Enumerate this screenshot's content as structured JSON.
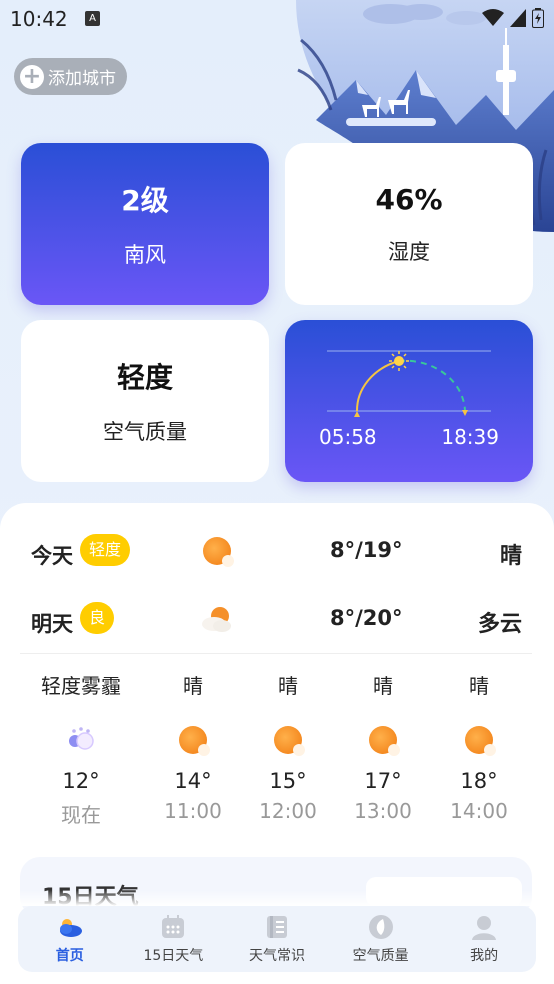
{
  "status": {
    "time": "10:42",
    "notif": "A"
  },
  "add_city": {
    "label": "添加城市"
  },
  "cards": {
    "wind": {
      "value": "2级",
      "label": "南风"
    },
    "humidity": {
      "value": "46%",
      "label": "湿度"
    },
    "air": {
      "value": "轻度",
      "label": "空气质量"
    },
    "sun": {
      "sunrise": "05:58",
      "sunset": "18:39"
    }
  },
  "days": [
    {
      "name": "今天",
      "aqi": "轻度",
      "temp": "8°/19°",
      "weather": "晴",
      "icon": "sunny-icon"
    },
    {
      "name": "明天",
      "aqi": "良",
      "temp": "8°/20°",
      "weather": "多云",
      "icon": "cloudy-icon"
    }
  ],
  "hourly": [
    {
      "weather": "轻度雾霾",
      "temp": "12°",
      "time": "现在",
      "icon": "haze-icon"
    },
    {
      "weather": "晴",
      "temp": "14°",
      "time": "11:00",
      "icon": "sunny-icon"
    },
    {
      "weather": "晴",
      "temp": "15°",
      "time": "12:00",
      "icon": "sunny-icon"
    },
    {
      "weather": "晴",
      "temp": "17°",
      "time": "13:00",
      "icon": "sunny-icon"
    },
    {
      "weather": "晴",
      "temp": "18°",
      "time": "14:00",
      "icon": "sunny-icon"
    }
  ],
  "peek": {
    "title": "15日天气"
  },
  "tabs": [
    {
      "label": "首页",
      "icon": "home-weather-icon",
      "active": true
    },
    {
      "label": "15日天气",
      "icon": "calendar-icon",
      "active": false
    },
    {
      "label": "天气常识",
      "icon": "book-icon",
      "active": false
    },
    {
      "label": "空气质量",
      "icon": "leaf-icon",
      "active": false
    },
    {
      "label": "我的",
      "icon": "user-icon",
      "active": false
    }
  ],
  "colors": {
    "accent": "#2a5fe0",
    "card_gradient_top": "#2a4fd6",
    "card_gradient_bottom": "#6a56f6",
    "badge": "#ffcd00",
    "sun": "#f07a10"
  }
}
